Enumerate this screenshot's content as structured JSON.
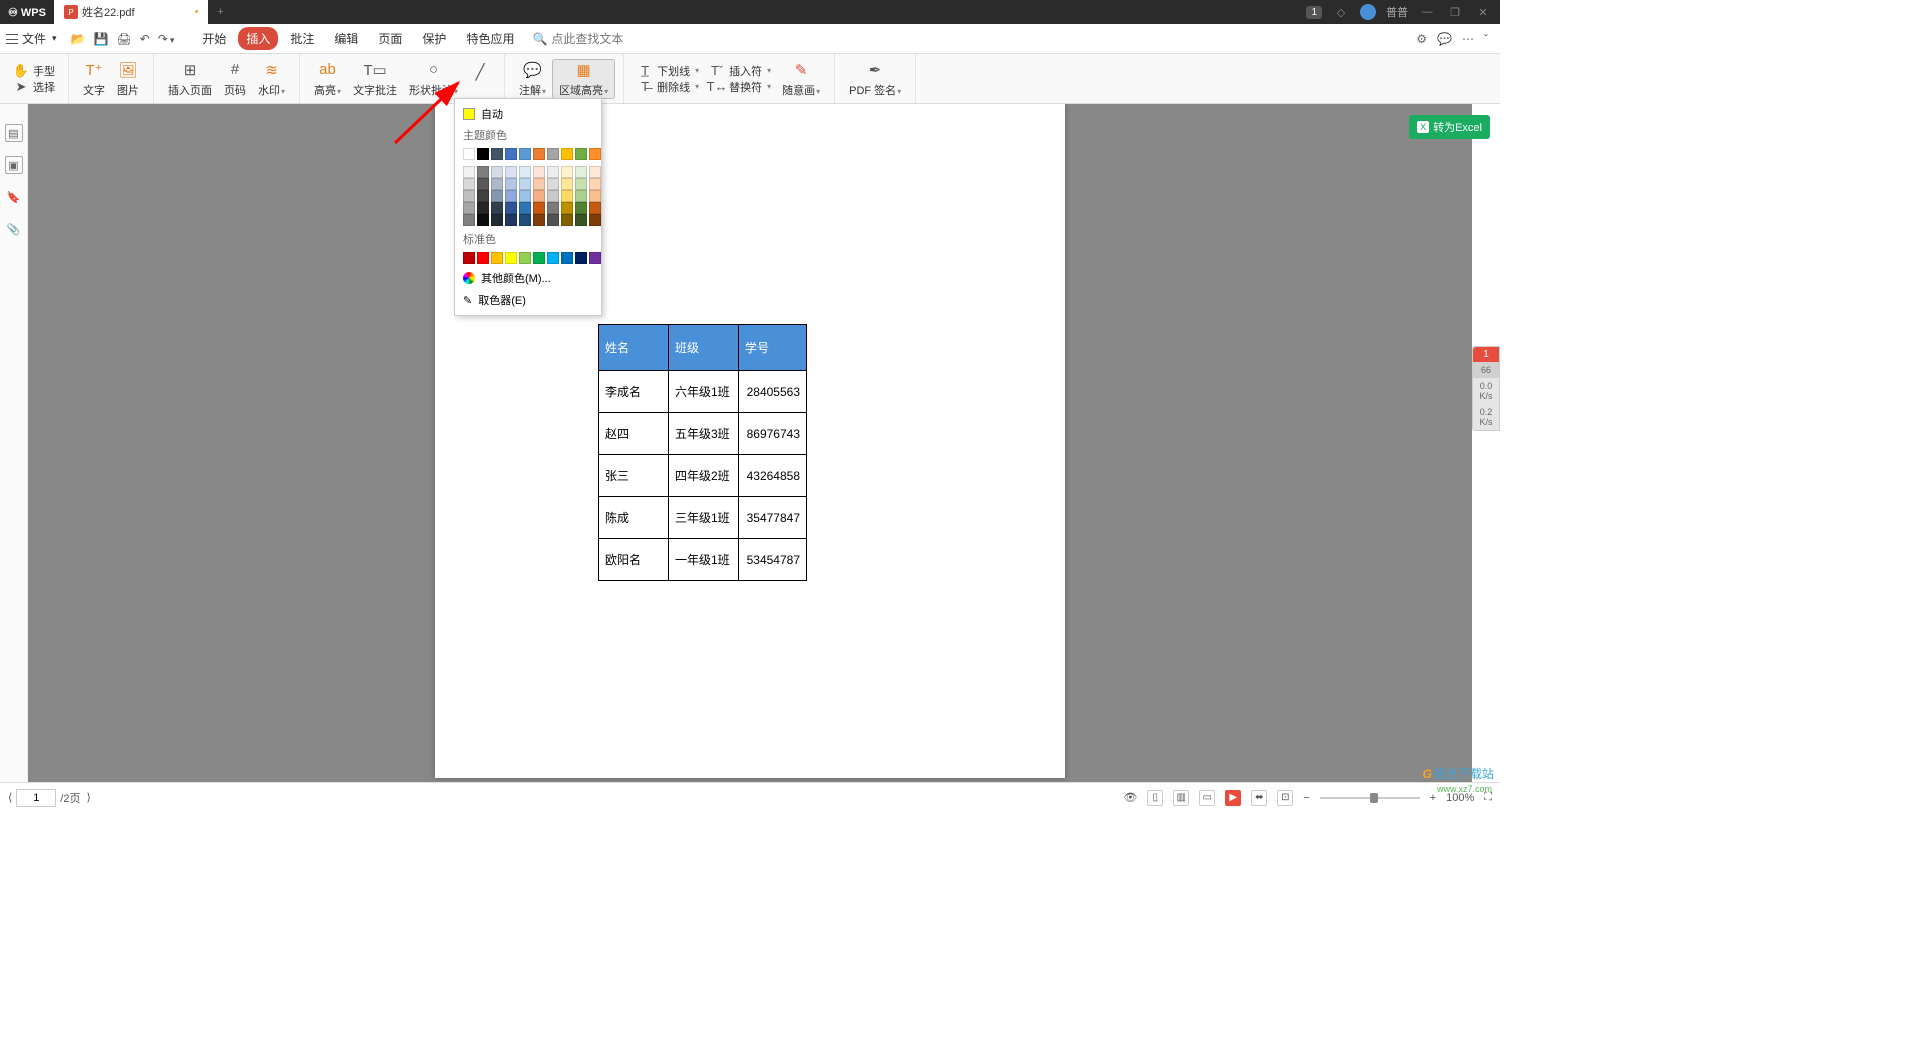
{
  "titlebar": {
    "app": "WPS",
    "tab_name": "姓名22.pdf",
    "modified_mark": "•",
    "new_tab": "+",
    "badge": "1",
    "user": "普普"
  },
  "menubar": {
    "file": "文件",
    "tabs": [
      "开始",
      "插入",
      "批注",
      "编辑",
      "页面",
      "保护",
      "特色应用"
    ],
    "active_tab_index": 1,
    "search_placeholder": "点此查找文本"
  },
  "ribbon": {
    "hand": "手型",
    "select": "选择",
    "text": "文字",
    "image": "图片",
    "insert_page": "插入页面",
    "page_number": "页码",
    "watermark": "水印",
    "highlight": "高亮",
    "text_annot": "文字批注",
    "shape_annot": "形状批注",
    "note": "注解",
    "area_highlight": "区域高亮",
    "underline": "下划线",
    "strikeout": "删除线",
    "insert_char": "插入符",
    "replace_char": "替换符",
    "freehand": "随意画",
    "pdf_sign": "PDF 签名"
  },
  "color_popup": {
    "auto": "自动",
    "theme_label": "主题颜色",
    "standard_label": "标准色",
    "more_colors": "其他颜色(M)...",
    "eyedropper": "取色器(E)",
    "theme_row1": [
      "#ffffff",
      "#000000",
      "#44546a",
      "#4472c4",
      "#5b9bd5",
      "#ed7d31",
      "#a5a5a5",
      "#ffc000",
      "#70ad47",
      "#ff8f2b"
    ],
    "theme_shades": [
      [
        "#f2f2f2",
        "#7f7f7f",
        "#d6dce5",
        "#d9e1f2",
        "#deeaf6",
        "#fce4d6",
        "#ededed",
        "#fff2cc",
        "#e2efda",
        "#fde9d9"
      ],
      [
        "#d9d9d9",
        "#595959",
        "#adb9ca",
        "#b4c6e7",
        "#bdd7ee",
        "#f8cbad",
        "#dbdbdb",
        "#ffe699",
        "#c6e0b4",
        "#fcd5b4"
      ],
      [
        "#bfbfbf",
        "#404040",
        "#8497b0",
        "#8ea9db",
        "#9bc2e6",
        "#f4b084",
        "#c9c9c9",
        "#ffd966",
        "#a9d08e",
        "#fabf8f"
      ],
      [
        "#a6a6a6",
        "#262626",
        "#333f4f",
        "#305496",
        "#2f75b5",
        "#c65911",
        "#7b7b7b",
        "#bf8f00",
        "#548235",
        "#c55a11"
      ],
      [
        "#808080",
        "#0d0d0d",
        "#222b35",
        "#203764",
        "#1f4e78",
        "#833c0c",
        "#525252",
        "#806000",
        "#375623",
        "#7f3b08"
      ]
    ],
    "standard": [
      "#c00000",
      "#ff0000",
      "#ffc000",
      "#ffff00",
      "#92d050",
      "#00b050",
      "#00b0f0",
      "#0070c0",
      "#002060",
      "#7030a0"
    ]
  },
  "table": {
    "headers": [
      "姓名",
      "班级",
      "学号"
    ],
    "rows": [
      [
        "李成名",
        "六年级1班",
        "28405563"
      ],
      [
        "赵四",
        "五年级3班",
        "86976743"
      ],
      [
        "张三",
        "四年级2班",
        "43264858"
      ],
      [
        "陈成",
        "三年级1班",
        "35477847"
      ],
      [
        "欧阳名",
        "一年级1班",
        "53454787"
      ]
    ]
  },
  "right_badge": "转为Excel",
  "speed": {
    "alert": "1",
    "val1": "66",
    "val2": "0.0",
    "unit2": "K/s",
    "val3": "0.2",
    "unit3": "K/s"
  },
  "statusbar": {
    "page_current": "1",
    "page_total": "/2页",
    "zoom": "100%"
  },
  "watermark": {
    "brand": "极光下载站",
    "url": "www.xz7.com"
  }
}
